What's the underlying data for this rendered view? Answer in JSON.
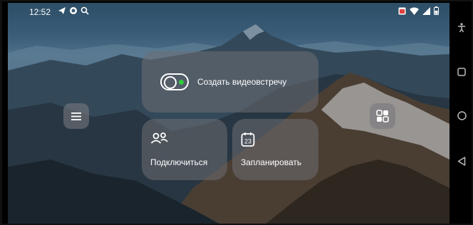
{
  "status_bar": {
    "time": "12:52",
    "left_icons": [
      "telegram-icon",
      "chat-app-icon",
      "search-icon"
    ],
    "right_icons": [
      "calendar-notification-icon",
      "wifi-icon",
      "signal-icon",
      "battery-icon"
    ]
  },
  "main": {
    "create_meeting_label": "Создать видеовстречу",
    "connect_label": "Подключиться",
    "schedule_label": "Запланировать",
    "calendar_day": "23"
  },
  "side_buttons": {
    "menu_icon": "hamburger-menu-icon",
    "apps_icon": "apps-grid-icon"
  },
  "navigation_bar": [
    "accessibility-icon",
    "recents-icon",
    "home-icon",
    "back-icon"
  ],
  "colors": {
    "card_background": "rgba(110,110,115,0.55)",
    "toggle_dot": "#2ecc40"
  }
}
